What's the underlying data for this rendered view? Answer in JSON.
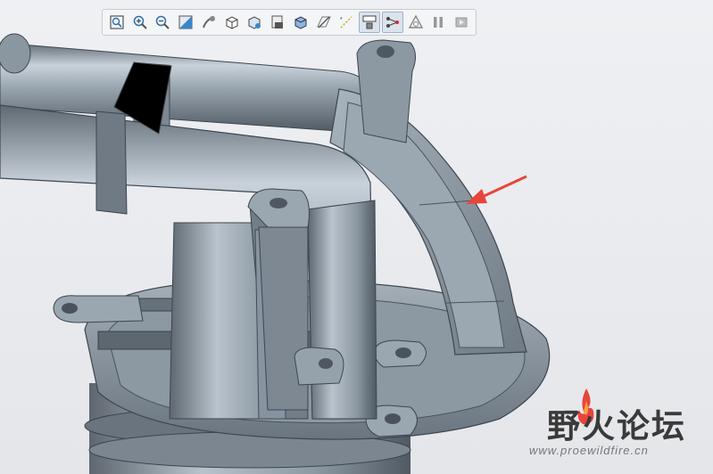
{
  "toolbar": {
    "buttons": [
      {
        "name": "refit-icon",
        "active": false
      },
      {
        "name": "zoom-in-icon",
        "active": false
      },
      {
        "name": "zoom-out-icon",
        "active": false
      },
      {
        "name": "repaint-icon",
        "active": false
      },
      {
        "name": "spin-center-icon",
        "active": false
      },
      {
        "name": "saved-orientations-icon",
        "active": false
      },
      {
        "name": "view-manager-icon",
        "active": false
      },
      {
        "name": "display-style-icon",
        "active": false
      },
      {
        "name": "perspective-view-icon",
        "active": false
      },
      {
        "name": "datum-planes-icon",
        "active": false
      },
      {
        "name": "datum-axes-icon",
        "active": false
      },
      {
        "name": "annotation-display-icon",
        "active": true
      },
      {
        "name": "datum-points-icon",
        "active": true
      },
      {
        "name": "csys-display-icon",
        "active": false
      },
      {
        "name": "pause-icon",
        "active": false
      },
      {
        "name": "next-icon",
        "active": false
      }
    ]
  },
  "watermark": {
    "title": "野火论坛",
    "url": "www.proewildfire.cn"
  },
  "colors": {
    "model": "#8e9aa5",
    "model_dark": "#5d6670",
    "model_light": "#c7d0d8",
    "arrow": "#e8453c"
  }
}
